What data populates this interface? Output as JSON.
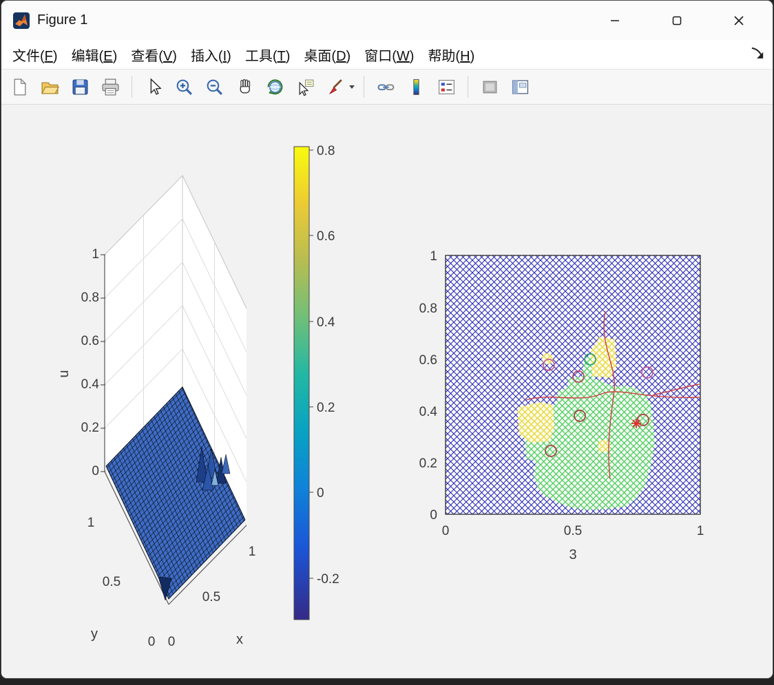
{
  "window": {
    "title": "Figure 1"
  },
  "menu": {
    "items": [
      {
        "pre": "文件(",
        "key": "F",
        "post": ")"
      },
      {
        "pre": "编辑(",
        "key": "E",
        "post": ")"
      },
      {
        "pre": "查看(",
        "key": "V",
        "post": ")"
      },
      {
        "pre": "插入(",
        "key": "I",
        "post": ")"
      },
      {
        "pre": "工具(",
        "key": "T",
        "post": ")"
      },
      {
        "pre": "桌面(",
        "key": "D",
        "post": ")"
      },
      {
        "pre": "窗口(",
        "key": "W",
        "post": ")"
      },
      {
        "pre": "帮助(",
        "key": "H",
        "post": ")"
      }
    ]
  },
  "toolbar": {
    "icons": [
      "new-file-icon",
      "open-file-icon",
      "save-icon",
      "print-icon",
      "edit-plot-pointer-icon",
      "zoom-in-icon",
      "zoom-out-icon",
      "pan-hand-icon",
      "rotate-3d-icon",
      "data-cursor-icon",
      "brush-data-icon",
      "brush-dropdown-caret",
      "link-plots-icon",
      "insert-colorbar-icon",
      "insert-legend-icon",
      "hide-plot-tools-icon",
      "show-plot-tools-dock-icon"
    ]
  },
  "figure": {
    "surface_plot": {
      "zlabel": "u",
      "xlabel": "x",
      "ylabel": "y",
      "z_ticks": [
        "1",
        "0.8",
        "0.6",
        "0.4",
        "0.2",
        "0"
      ],
      "x_ticks": [
        "0",
        "0.5",
        "1"
      ],
      "y_ticks": [
        "1",
        "0.5",
        "0"
      ]
    },
    "colorbar": {
      "ticks": [
        "0.8",
        "0.6",
        "0.4",
        "0.2",
        "0",
        "-0.2"
      ]
    },
    "mesh_plot": {
      "xlabel": "3",
      "x_ticks": [
        "0",
        "0.5",
        "1"
      ],
      "y_ticks": [
        "1",
        "0.8",
        "0.6",
        "0.4",
        "0.2",
        "0"
      ]
    }
  },
  "colors": {
    "surface_blue": "#3f6dc6",
    "lattice_blue": "#2929b4",
    "lattice_green": "#4ecb5e",
    "lattice_yellow": "#e6d84a",
    "line_red": "#d04040"
  },
  "chart_data": [
    {
      "type": "surface",
      "title": "",
      "xlabel": "x",
      "ylabel": "y",
      "zlabel": "u",
      "xlim": [
        0,
        1
      ],
      "ylim": [
        0,
        1
      ],
      "zlim": [
        0,
        1
      ],
      "x_ticks": [
        0,
        0.5,
        1
      ],
      "y_ticks": [
        0,
        0.5,
        1
      ],
      "z_ticks": [
        0,
        0.2,
        0.4,
        0.6,
        0.8,
        1
      ],
      "colormap": "parula",
      "description": "Dense blue mesh surface lying near u≈0 over the unit square; a cluster of narrow spikes up to u≈0.35 right of center and one narrow downward spike near the front-left edge."
    },
    {
      "type": "colorbar",
      "orientation": "vertical",
      "ticks": [
        0.8,
        0.6,
        0.4,
        0.2,
        0,
        -0.2
      ],
      "range": [
        -0.3,
        0.81
      ],
      "colormap": "parula"
    },
    {
      "type": "scatter",
      "title": "",
      "xlabel": "3",
      "ylabel": "",
      "xlim": [
        0,
        1
      ],
      "ylim": [
        0,
        1
      ],
      "x_ticks": [
        0,
        0.5,
        1
      ],
      "y_ticks": [
        0,
        0.2,
        0.4,
        0.6,
        0.8,
        1
      ],
      "background": "blue cross-hatched lattice over full axes",
      "regions": [
        {
          "name": "green cross-hatched blob",
          "x_range": [
            0.31,
            0.82
          ],
          "y_range": [
            0.08,
            0.55
          ]
        },
        {
          "name": "yellow patch left",
          "x_range": [
            0.28,
            0.43
          ],
          "y_range": [
            0.28,
            0.43
          ]
        },
        {
          "name": "yellow patch upper",
          "x_range": [
            0.57,
            0.67
          ],
          "y_range": [
            0.53,
            0.69
          ]
        },
        {
          "name": "yellow dot",
          "x": 0.62,
          "y": 0.26
        },
        {
          "name": "yellow dot",
          "x": 0.4,
          "y": 0.6
        }
      ],
      "markers": {
        "circles": [
          [
            0.41,
            0.58
          ],
          [
            0.52,
            0.53
          ],
          [
            0.57,
            0.6
          ],
          [
            0.79,
            0.55
          ],
          [
            0.53,
            0.38
          ],
          [
            0.78,
            0.36
          ],
          [
            0.41,
            0.24
          ]
        ],
        "asterisk": [
          0.75,
          0.35
        ]
      },
      "lines": [
        {
          "color": "red",
          "shape": "wavy horizontal",
          "from": [
            0.32,
            0.45
          ],
          "to": [
            1.0,
            0.45
          ]
        },
        {
          "color": "red",
          "shape": "wavy vertical",
          "from": [
            0.63,
            0.79
          ],
          "to": [
            0.65,
            0.14
          ]
        }
      ]
    }
  ]
}
